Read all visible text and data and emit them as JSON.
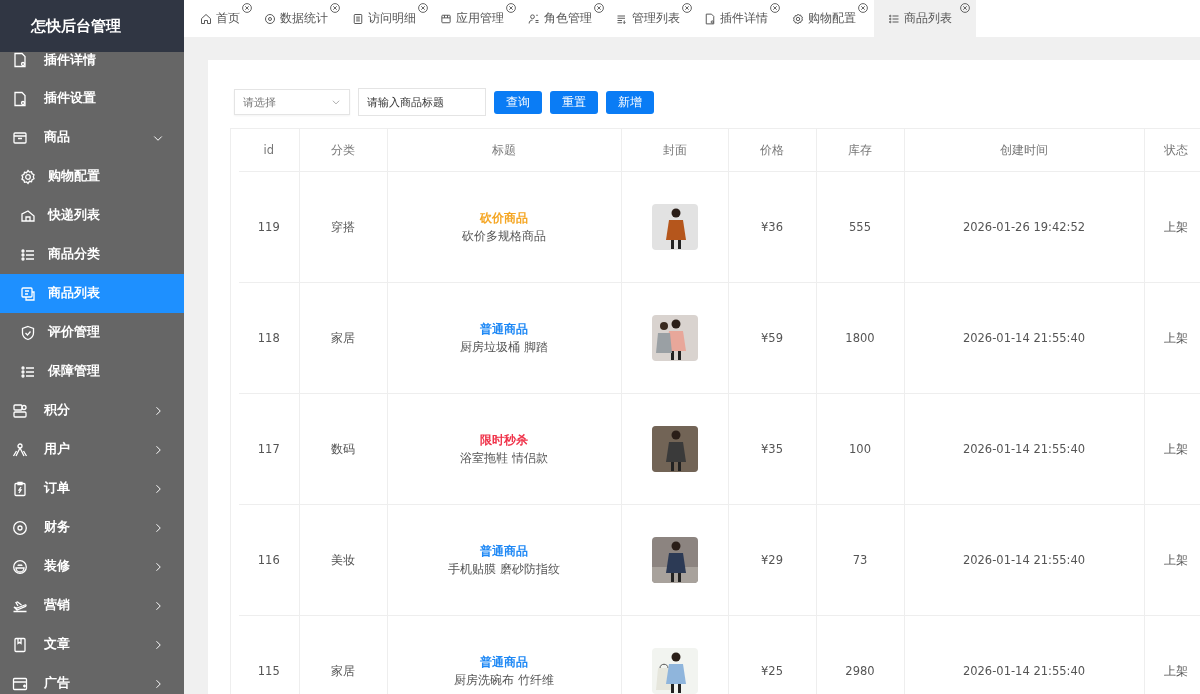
{
  "logo": "怎快后台管理",
  "menu": [
    {
      "label": "插件详情",
      "selected": false
    },
    {
      "label": "插件设置",
      "selected": false
    },
    {
      "label": "商品",
      "selected": false,
      "expanded": true,
      "children": [
        {
          "label": "购物配置",
          "selected": false
        },
        {
          "label": "快递列表",
          "selected": false
        },
        {
          "label": "商品分类",
          "selected": false
        },
        {
          "label": "商品列表",
          "selected": true
        },
        {
          "label": "评价管理",
          "selected": false
        },
        {
          "label": "保障管理",
          "selected": false
        }
      ]
    },
    {
      "label": "积分",
      "selected": false,
      "expanded": false
    },
    {
      "label": "用户",
      "selected": false,
      "expanded": false
    },
    {
      "label": "订单",
      "selected": false,
      "expanded": false
    },
    {
      "label": "财务",
      "selected": false,
      "expanded": false
    },
    {
      "label": "装修",
      "selected": false,
      "expanded": false
    },
    {
      "label": "营销",
      "selected": false,
      "expanded": false
    },
    {
      "label": "文章",
      "selected": false,
      "expanded": false
    },
    {
      "label": "广告",
      "selected": false,
      "expanded": false
    }
  ],
  "tabs": [
    {
      "label": "首页",
      "selected": false
    },
    {
      "label": "数据统计",
      "selected": false
    },
    {
      "label": "访问明细",
      "selected": false
    },
    {
      "label": "应用管理",
      "selected": false
    },
    {
      "label": "角色管理",
      "selected": false
    },
    {
      "label": "管理列表",
      "selected": false
    },
    {
      "label": "插件详情",
      "selected": false
    },
    {
      "label": "购物配置",
      "selected": false
    },
    {
      "label": "商品列表",
      "selected": true
    }
  ],
  "filters": {
    "select_placeholder": "请选择",
    "title_placeholder": "请输入商品标题",
    "buttons": [
      "查询",
      "重置",
      "新增"
    ]
  },
  "table": {
    "columns": [
      "id",
      "分类",
      "标题",
      "封面",
      "价格",
      "库存",
      "创建时间",
      "状态"
    ],
    "rows": [
      {
        "id": "119",
        "category": "穿搭",
        "tag": {
          "text": "砍价商品",
          "color": "#f5a623"
        },
        "title": "砍价多规格商品",
        "price": "¥36",
        "stock": "555",
        "created": "2026-01-26 19:42:52",
        "status": "上架"
      },
      {
        "id": "118",
        "category": "家居",
        "tag": {
          "text": "普通商品",
          "color": "#1e88f5"
        },
        "title": "厨房垃圾桶 脚踏",
        "price": "¥59",
        "stock": "1800",
        "created": "2026-01-14 21:55:40",
        "status": "上架"
      },
      {
        "id": "117",
        "category": "数码",
        "tag": {
          "text": "限时秒杀",
          "color": "#f0334a"
        },
        "title": "浴室拖鞋 情侣款",
        "price": "¥35",
        "stock": "100",
        "created": "2026-01-14 21:55:40",
        "status": "上架"
      },
      {
        "id": "116",
        "category": "美妆",
        "tag": {
          "text": "普通商品",
          "color": "#1e88f5"
        },
        "title": "手机贴膜 磨砂防指纹",
        "price": "¥29",
        "stock": "73",
        "created": "2026-01-14 21:55:40",
        "status": "上架"
      },
      {
        "id": "115",
        "category": "家居",
        "tag": {
          "text": "普通商品",
          "color": "#1e88f5"
        },
        "title": "厨房洗碗布 竹纤维",
        "price": "¥25",
        "stock": "2980",
        "created": "2026-01-14 21:55:40",
        "status": "上架"
      }
    ]
  }
}
